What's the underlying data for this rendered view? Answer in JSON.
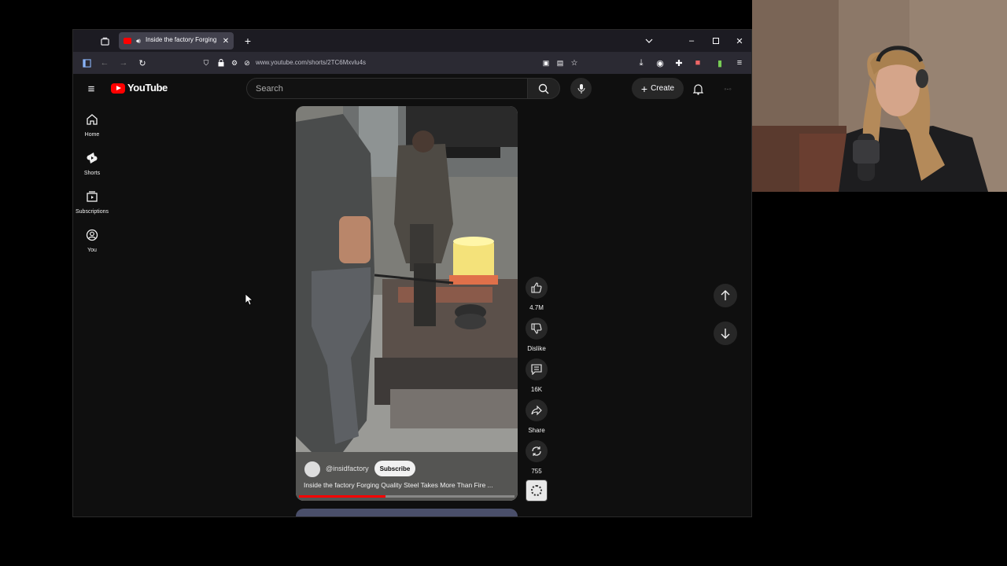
{
  "browser": {
    "tab_title": "Inside the factory Forging Q",
    "url": "www.youtube.com/shorts/2TC6Mxvlu4s"
  },
  "youtube": {
    "logo_text": "YouTube",
    "search_placeholder": "Search",
    "create_label": "Create",
    "sidebar": [
      {
        "label": "Home",
        "icon": "home-icon"
      },
      {
        "label": "Shorts",
        "icon": "shorts-icon"
      },
      {
        "label": "Subscriptions",
        "icon": "subscriptions-icon"
      },
      {
        "label": "You",
        "icon": "you-icon"
      }
    ]
  },
  "short": {
    "channel": "@insidfactory",
    "subscribe_label": "Subscribe",
    "title": "Inside the factory Forging Quality Steel Takes More Than Fire ...",
    "progress_fraction": 0.4,
    "actions": {
      "like_count": "4.7M",
      "dislike_label": "Dislike",
      "comment_count": "16K",
      "share_label": "Share",
      "remix_count": "755"
    }
  },
  "colors": {
    "accent": "#ff0000",
    "page_bg": "#0f0f0f"
  }
}
